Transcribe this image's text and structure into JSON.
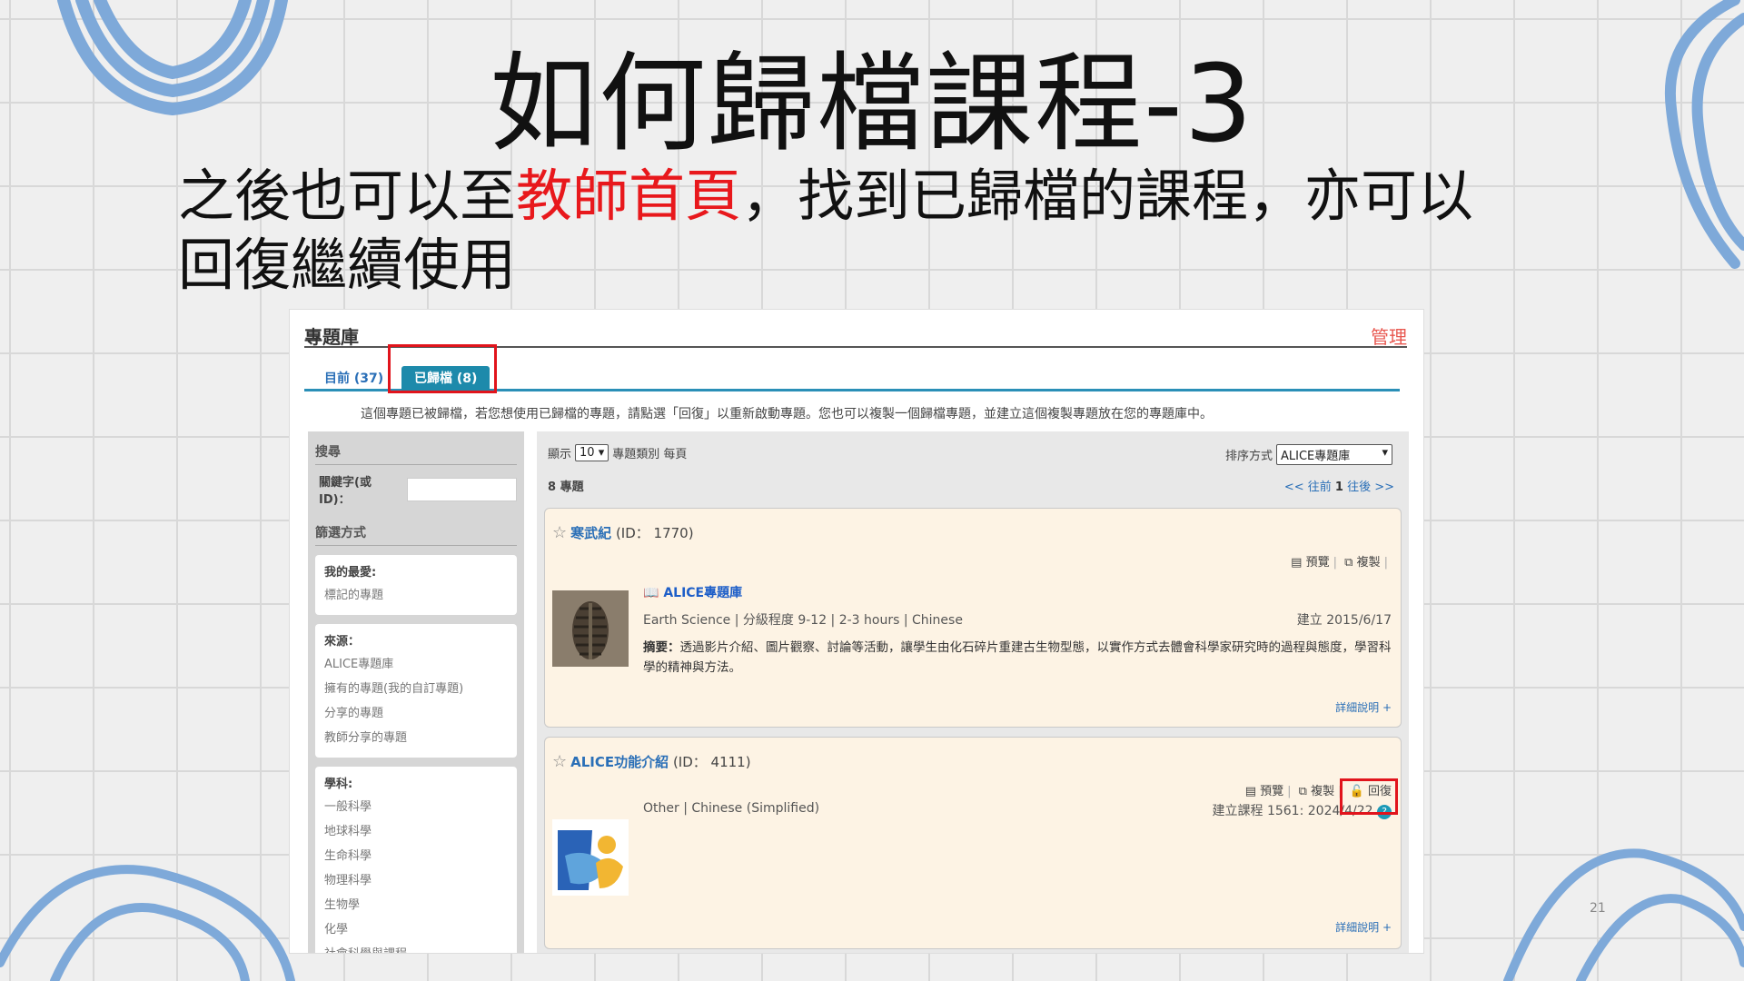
{
  "slide": {
    "title": "如何歸檔課程-3",
    "text_line1_before": "之後也可以至",
    "text_line1_highlight": "教師首頁",
    "text_line1_after": "，找到已歸檔的課程，亦可以",
    "text_line2": "回復繼續使用",
    "page_number": "21"
  },
  "shot": {
    "header_title": "專題庫",
    "manage_link": "管理",
    "tabs": [
      {
        "label": "目前 (37)"
      },
      {
        "label": "已歸檔 (8)"
      }
    ],
    "notice": "這個專題已被歸檔，若您想使用已歸檔的專題，請點選「回復」以重新啟動專題。您也可以複製一個歸檔專題，並建立這個複製專題放在您的專題庫中。",
    "sidebar": {
      "search_heading": "搜尋",
      "keyword_label": "關鍵字(或ID)：",
      "filter_heading": "篩選方式",
      "favorites_label": "我的最愛:",
      "favorites_items": [
        "標記的專題"
      ],
      "source_label": "來源：",
      "source_items": [
        "ALICE專題庫",
        "擁有的專題(我的自訂專題)",
        "分享的專題",
        "教師分享的專題"
      ],
      "subject_label": "學科:",
      "subject_items": [
        "一般科學",
        "地球科學",
        "生命科學",
        "物理科學",
        "生物學",
        "化學",
        "社會科學與課程"
      ]
    },
    "controls": {
      "show_label": "顯示",
      "show_value": "10",
      "per_page_label": "專題類別 每頁",
      "sort_label": "排序方式",
      "sort_value": "ALICE專題庫",
      "count": "8 專題",
      "pager_prev": "<< 往前",
      "pager_page": "1",
      "pager_next": "往後 >>"
    },
    "cards": [
      {
        "name": "寒武紀",
        "id_text": "(ID： 1770)",
        "preview": "預覽",
        "copy": "複製",
        "source": "ALICE專題庫",
        "meta": "Earth Science | 分級程度 9-12 | 2-3 hours | Chinese",
        "created": "建立 2015/6/17",
        "summary_label": "摘要：",
        "summary": "透過影片介紹、圖片觀察、討論等活動，讓學生由化石碎片重建古生物型態，以實作方式去體會科學家研究時的過程與態度，學習科學的精神與方法。",
        "detail": "詳細說明 +"
      },
      {
        "name": "ALICE功能介紹",
        "id_text": "(ID： 4111)",
        "preview": "預覽",
        "copy": "複製",
        "restore": "回復",
        "meta": "Other | Chinese (Simplified)",
        "created": "建立課程 1561: 2024/4/22",
        "detail": "詳細說明 +"
      }
    ]
  },
  "colors": {
    "highlight_red": "#e8181c",
    "tab_blue": "#1d8aab",
    "link_blue": "#2a6fb7",
    "card_bg": "#fdf3e4"
  }
}
